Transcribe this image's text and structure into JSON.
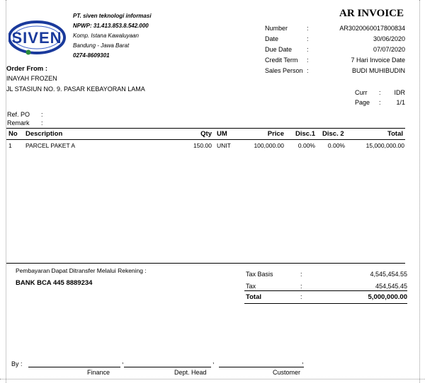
{
  "company": {
    "name": "PT. siven teknologi informasi",
    "npwp": "NPWP: 31.413.853.8.542.000",
    "address1": "Komp. Istana Kawaluyaan",
    "address2": "Bandung - Jawa Barat",
    "phone": "0274-8609301",
    "logo_text": "SIVEN"
  },
  "doc_title": "AR INVOICE",
  "meta": {
    "number_label": "Number",
    "number": "AR3020060017800834",
    "date_label": "Date",
    "date": "30/06/2020",
    "due_label": "Due Date",
    "due": "07/07/2020",
    "credit_label": "Credit Term",
    "credit": "7 Hari Invoice Date",
    "sales_label": "Sales Person",
    "sales": "BUDI MUHIBUDIN",
    "sep": ":"
  },
  "order_from": {
    "label": "Order From :",
    "name": "INAYAH FROZEN",
    "address": "JL STASIUN NO. 9. PASAR KEBAYORAN LAMA"
  },
  "curr": {
    "curr_label": "Curr",
    "curr": "IDR",
    "page_label": "Page",
    "page": "1/1",
    "sep": ":"
  },
  "ref": {
    "ref_label": "Ref. PO",
    "remark_label": "Remark",
    "sep": ":"
  },
  "table": {
    "headers": {
      "no": "No",
      "desc": "Description",
      "qty": "Qty",
      "um": "UM",
      "price": "Price",
      "disc1": "Disc.1",
      "disc2": "Disc. 2",
      "total": "Total"
    },
    "rows": [
      {
        "no": "1",
        "desc": "PARCEL PAKET A",
        "qty": "150.00",
        "um": "UNIT",
        "price": "100,000.00",
        "disc1": "0.00%",
        "disc2": "0.00%",
        "total": "15,000,000.00"
      }
    ]
  },
  "payment": {
    "note": "Pembayaran Dapat Ditransfer Melalui Rekening :",
    "bank": "BANK BCA 445 8889234"
  },
  "totals": {
    "tax_basis_label": "Tax Basis",
    "tax_basis": "4,545,454.55",
    "tax_label": "Tax",
    "tax": "454,545.45",
    "total_label": "Total",
    "total": "5,000,000.00",
    "sep": ":"
  },
  "signatures": {
    "by": "By :",
    "finance": "Finance",
    "dept_head": "Dept. Head",
    "customer": "Customer",
    "comma": ","
  }
}
